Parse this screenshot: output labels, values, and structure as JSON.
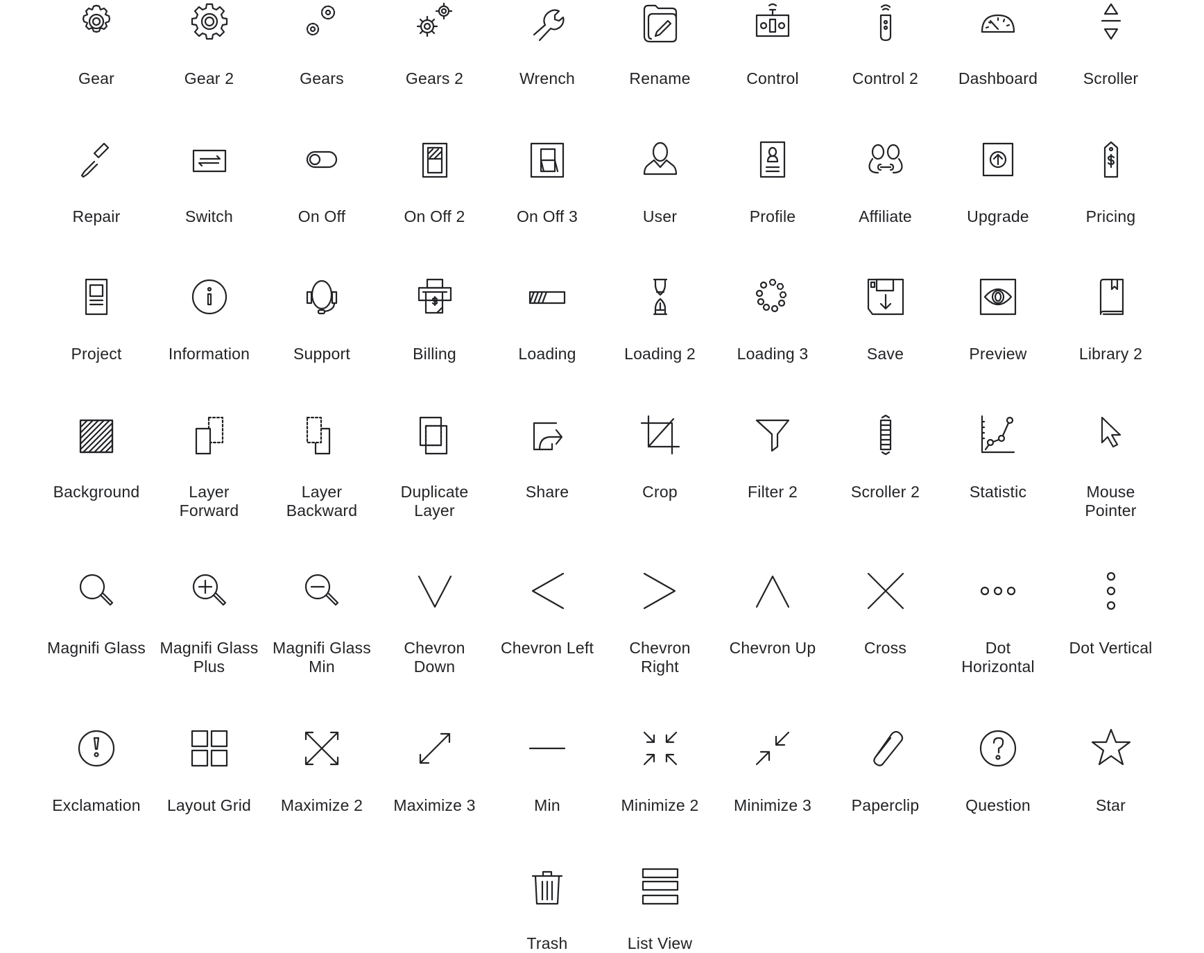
{
  "icon_sheet": {
    "rows": [
      [
        {
          "label": "Gear",
          "icon": "gear-icon"
        },
        {
          "label": "Gear 2",
          "icon": "gear-2-icon"
        },
        {
          "label": "Gears",
          "icon": "gears-icon"
        },
        {
          "label": "Gears 2",
          "icon": "gears-2-icon"
        },
        {
          "label": "Wrench",
          "icon": "wrench-icon"
        },
        {
          "label": "Rename",
          "icon": "rename-icon"
        },
        {
          "label": "Control",
          "icon": "control-icon"
        },
        {
          "label": "Control 2",
          "icon": "control-2-icon"
        },
        {
          "label": "Dashboard",
          "icon": "dashboard-icon"
        },
        {
          "label": "Scroller",
          "icon": "scroller-icon"
        }
      ],
      [
        {
          "label": "Repair",
          "icon": "repair-icon"
        },
        {
          "label": "Switch",
          "icon": "switch-icon"
        },
        {
          "label": "On Off",
          "icon": "on-off-icon"
        },
        {
          "label": "On Off 2",
          "icon": "on-off-2-icon"
        },
        {
          "label": "On Off 3",
          "icon": "on-off-3-icon"
        },
        {
          "label": "User",
          "icon": "user-icon"
        },
        {
          "label": "Profile",
          "icon": "profile-icon"
        },
        {
          "label": "Affiliate",
          "icon": "affiliate-icon"
        },
        {
          "label": "Upgrade",
          "icon": "upgrade-icon"
        },
        {
          "label": "Pricing",
          "icon": "pricing-icon"
        }
      ],
      [
        {
          "label": "Project",
          "icon": "project-icon"
        },
        {
          "label": "Information",
          "icon": "information-icon"
        },
        {
          "label": "Support",
          "icon": "support-icon"
        },
        {
          "label": "Billing",
          "icon": "billing-icon"
        },
        {
          "label": "Loading",
          "icon": "loading-icon"
        },
        {
          "label": "Loading 2",
          "icon": "loading-2-icon"
        },
        {
          "label": "Loading 3",
          "icon": "loading-3-icon"
        },
        {
          "label": "Save",
          "icon": "save-icon"
        },
        {
          "label": "Preview",
          "icon": "preview-icon"
        },
        {
          "label": "Library 2",
          "icon": "library-2-icon"
        }
      ],
      [
        {
          "label": "Background",
          "icon": "background-icon"
        },
        {
          "label": "Layer\nForward",
          "icon": "layer-forward-icon"
        },
        {
          "label": "Layer\nBackward",
          "icon": "layer-backward-icon"
        },
        {
          "label": "Duplicate\nLayer",
          "icon": "duplicate-layer-icon"
        },
        {
          "label": "Share",
          "icon": "share-icon"
        },
        {
          "label": "Crop",
          "icon": "crop-icon"
        },
        {
          "label": "Filter 2",
          "icon": "filter-2-icon"
        },
        {
          "label": "Scroller 2",
          "icon": "scroller-2-icon"
        },
        {
          "label": "Statistic",
          "icon": "statistic-icon"
        },
        {
          "label": "Mouse\nPointer",
          "icon": "mouse-pointer-icon"
        }
      ],
      [
        {
          "label": "Magnifi Glass",
          "icon": "magnifi-glass-icon"
        },
        {
          "label": "Magnifi Glass\nPlus",
          "icon": "magnifi-glass-plus-icon"
        },
        {
          "label": "Magnifi Glass\nMin",
          "icon": "magnifi-glass-min-icon"
        },
        {
          "label": "Chevron\nDown",
          "icon": "chevron-down-icon"
        },
        {
          "label": "Chevron Left",
          "icon": "chevron-left-icon"
        },
        {
          "label": "Chevron\nRight",
          "icon": "chevron-right-icon"
        },
        {
          "label": "Chevron Up",
          "icon": "chevron-up-icon"
        },
        {
          "label": "Cross",
          "icon": "cross-icon"
        },
        {
          "label": "Dot\nHorizontal",
          "icon": "dot-horizontal-icon"
        },
        {
          "label": "Dot Vertical",
          "icon": "dot-vertical-icon"
        }
      ],
      [
        {
          "label": "Exclamation",
          "icon": "exclamation-icon"
        },
        {
          "label": "Layout Grid",
          "icon": "layout-grid-icon"
        },
        {
          "label": "Maximize 2",
          "icon": "maximize-2-icon"
        },
        {
          "label": "Maximize 3",
          "icon": "maximize-3-icon"
        },
        {
          "label": "Min",
          "icon": "min-icon"
        },
        {
          "label": "Minimize 2",
          "icon": "minimize-2-icon"
        },
        {
          "label": "Minimize 3",
          "icon": "minimize-3-icon"
        },
        {
          "label": "Paperclip",
          "icon": "paperclip-icon"
        },
        {
          "label": "Question",
          "icon": "question-icon"
        },
        {
          "label": "Star",
          "icon": "star-icon"
        }
      ],
      [
        {
          "label": "Trash",
          "icon": "trash-icon"
        },
        {
          "label": "List View",
          "icon": "list-view-icon"
        }
      ]
    ]
  }
}
